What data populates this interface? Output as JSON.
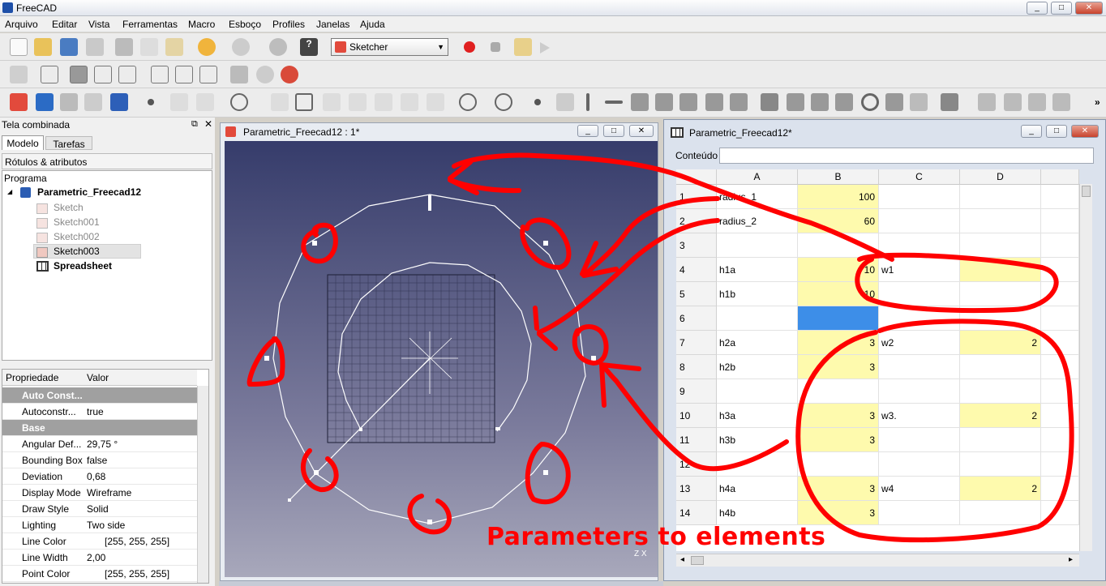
{
  "app": {
    "title": "FreeCAD"
  },
  "menu": [
    "Arquivo",
    "Editar",
    "Vista",
    "Ferramentas",
    "Macro",
    "Esboço",
    "Profiles",
    "Janelas",
    "Ajuda"
  ],
  "toolbar": {
    "workbench": "Sketcher"
  },
  "combo": {
    "title": "Tela combinada",
    "tabs": [
      "Modelo",
      "Tarefas"
    ],
    "labels_header": "Rótulos & atributos"
  },
  "tree": {
    "root": "Programa",
    "document": "Parametric_Freecad12",
    "items": [
      "Sketch",
      "Sketch001",
      "Sketch002",
      "Sketch003",
      "Spreadsheet"
    ]
  },
  "props": {
    "col_name": "Propriedade",
    "col_value": "Valor",
    "rows": [
      {
        "name": "Auto Const...",
        "value": "",
        "group": true
      },
      {
        "name": "Autoconstr...",
        "value": "true"
      },
      {
        "name": "Base",
        "value": "",
        "group": true
      },
      {
        "name": "Angular Def...",
        "value": "29,75 °"
      },
      {
        "name": "Bounding Box",
        "value": "false"
      },
      {
        "name": "Deviation",
        "value": "0,68"
      },
      {
        "name": "Display Mode",
        "value": "Wireframe"
      },
      {
        "name": "Draw Style",
        "value": "Solid"
      },
      {
        "name": "Lighting",
        "value": "Two side"
      },
      {
        "name": "Line Color",
        "value": "[255, 255, 255]"
      },
      {
        "name": "Line Width",
        "value": "2,00"
      },
      {
        "name": "Point Color",
        "value": "[255, 255, 255]"
      }
    ]
  },
  "view": {
    "title": "Parametric_Freecad12 : 1*"
  },
  "sheet": {
    "title": "Parametric_Freecad12*",
    "content_label": "Conteúdo",
    "columns": [
      "A",
      "B",
      "C",
      "D"
    ],
    "rows": [
      {
        "n": "1",
        "a": "radius_1",
        "b": "100",
        "c": "",
        "d": ""
      },
      {
        "n": "2",
        "a": "radius_2",
        "b": "60",
        "c": "",
        "d": ""
      },
      {
        "n": "3",
        "a": "",
        "b": "",
        "c": "",
        "d": ""
      },
      {
        "n": "4",
        "a": "h1a",
        "b": "10",
        "c": "w1",
        "d": ""
      },
      {
        "n": "5",
        "a": "h1b",
        "b": "10",
        "c": "",
        "d": ""
      },
      {
        "n": "6",
        "a": "",
        "b": "",
        "c": "",
        "d": ""
      },
      {
        "n": "7",
        "a": "h2a",
        "b": "3",
        "c": "w2",
        "d": "2"
      },
      {
        "n": "8",
        "a": "h2b",
        "b": "3",
        "c": "",
        "d": ""
      },
      {
        "n": "9",
        "a": "",
        "b": "",
        "c": "",
        "d": ""
      },
      {
        "n": "10",
        "a": "h3a",
        "b": "3",
        "c": "w3.",
        "d": "2"
      },
      {
        "n": "11",
        "a": "h3b",
        "b": "3",
        "c": "",
        "d": ""
      },
      {
        "n": "12",
        "a": "",
        "b": "",
        "c": "",
        "d": ""
      },
      {
        "n": "13",
        "a": "h4a",
        "b": "3",
        "c": "w4",
        "d": "2"
      },
      {
        "n": "14",
        "a": "h4b",
        "b": "3",
        "c": "",
        "d": ""
      }
    ]
  },
  "annotation": "Parameters to elements",
  "colors": {
    "annotation": "#ff0000",
    "param_cell": "#fefaad",
    "selected_cell": "#3d8ee8"
  }
}
